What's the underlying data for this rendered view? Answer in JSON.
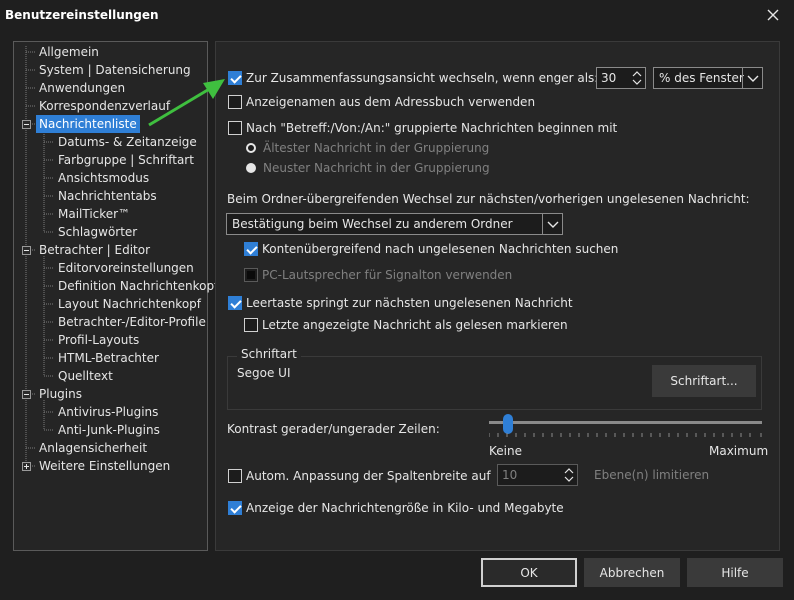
{
  "window": {
    "title": "Benutzereinstellungen"
  },
  "tree": {
    "items": [
      {
        "label": "Allgemein"
      },
      {
        "label": "System | Datensicherung"
      },
      {
        "label": "Anwendungen"
      },
      {
        "label": "Korrespondenzverlauf"
      },
      {
        "label": "Nachrichtenliste",
        "selected": true
      },
      {
        "label": "Datums- & Zeitanzeige"
      },
      {
        "label": "Farbgruppe | Schriftart"
      },
      {
        "label": "Ansichtsmodus"
      },
      {
        "label": "Nachrichtentabs"
      },
      {
        "label": "MailTicker™"
      },
      {
        "label": "Schlagwörter"
      },
      {
        "label": "Betrachter | Editor"
      },
      {
        "label": "Editorvoreinstellungen"
      },
      {
        "label": "Definition Nachrichtenkopf"
      },
      {
        "label": "Layout Nachrichtenkopf"
      },
      {
        "label": "Betrachter-/Editor-Profile"
      },
      {
        "label": "Profil-Layouts"
      },
      {
        "label": "HTML-Betrachter"
      },
      {
        "label": "Quelltext"
      },
      {
        "label": "Plugins"
      },
      {
        "label": "Antivirus-Plugins"
      },
      {
        "label": "Anti-Junk-Plugins"
      },
      {
        "label": "Anlagensicherheit"
      },
      {
        "label": "Weitere Einstellungen"
      }
    ]
  },
  "options": {
    "summary_view": {
      "label": "Zur Zusammenfassungsansicht wechseln, wenn enger als:",
      "checked": true,
      "value": "30",
      "unit": "% des Fenster"
    },
    "address_names": {
      "label": "Anzeigenamen aus dem Adressbuch verwenden",
      "checked": false
    },
    "grouped": {
      "label": "Nach \"Betreff:/Von:/An:\" gruppierte Nachrichten beginnen mit",
      "checked": false
    },
    "oldest": {
      "label": "Ältester Nachricht in der Gruppierung"
    },
    "newest": {
      "label": "Neuster Nachricht in der Gruppierung"
    },
    "cross_folder_heading": "Beim Ordner-übergreifenden Wechsel zur nächsten/vorherigen ungelesenen Nachricht:",
    "cross_folder_select": "Bestätigung beim Wechsel zu anderem Ordner",
    "cross_account": {
      "label": "Kontenübergreifend nach ungelesenen Nachrichten suchen",
      "checked": true
    },
    "pc_speaker": {
      "label": "PC-Lautsprecher für Signalton verwenden",
      "checked": false
    },
    "spacebar": {
      "label": "Leertaste springt zur nächsten ungelesenen Nachricht",
      "checked": true
    },
    "mark_read": {
      "label": "Letzte angezeigte Nachricht als gelesen markieren",
      "checked": false
    },
    "font": {
      "group_label": "Schriftart",
      "value": "Segoe UI",
      "button": "Schriftart..."
    },
    "contrast": {
      "label": "Kontrast gerader/ungerader Zeilen:",
      "min_label": "Keine",
      "max_label": "Maximum",
      "level": 0.07
    },
    "column_width": {
      "label": "Autom. Anpassung der Spaltenbreite auf",
      "checked": false,
      "value": "10",
      "suffix": "Ebene(n) limitieren"
    },
    "size_display": {
      "label": "Anzeige der Nachrichtengröße in Kilo- und Megabyte",
      "checked": true
    }
  },
  "buttons": {
    "ok": "OK",
    "cancel": "Abbrechen",
    "help": "Hilfe"
  },
  "colors": {
    "accent": "#2f7fd6",
    "arrow": "#3fbf3f",
    "background": "#1f1f1f"
  }
}
